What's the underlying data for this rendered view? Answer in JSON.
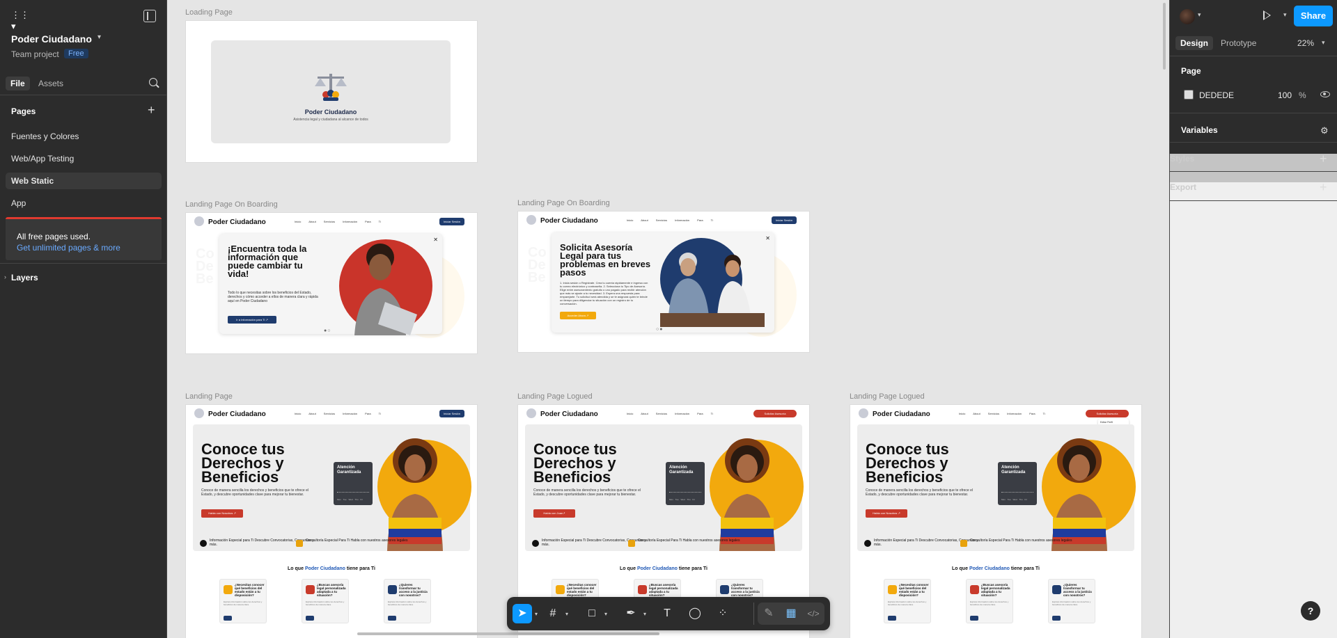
{
  "header": {
    "project_name": "Poder Ciudadano",
    "team": "Team project",
    "plan_badge": "Free",
    "share_label": "Share"
  },
  "left_tabs": {
    "file": "File",
    "assets": "Assets"
  },
  "pages": {
    "header": "Pages",
    "items": [
      {
        "label": "Fuentes y Colores",
        "selected": false
      },
      {
        "label": "Web/App Testing",
        "selected": false
      },
      {
        "label": "Web Static",
        "selected": true
      },
      {
        "label": "App",
        "selected": false
      }
    ]
  },
  "limit_notice": {
    "title": "All free pages used.",
    "link": "Get unlimited pages & more"
  },
  "layers_header": "Layers",
  "right_tabs": {
    "design": "Design",
    "prototype": "Prototype",
    "zoom": "22%"
  },
  "design_panel": {
    "page_header": "Page",
    "background_hex": "DEDEDE",
    "background_opacity": "100",
    "opacity_unit": "%",
    "variables": "Variables",
    "styles": "Styles",
    "export": "Export"
  },
  "frames": {
    "loading": {
      "label": "Loading Page",
      "title": "Poder Ciudadano",
      "subtitle": "Asistencia legal y ciudadana al alcance de todos"
    },
    "onboarding_1": {
      "label": "Landing Page On Boarding",
      "modal_title": "¡Encuentra toda la información que puede cambiar tu vida!",
      "modal_text": "Todo lo que necesitas sobre los beneficios del Estado, derechos y cómo acceder a ellos de manera clara y rápida aquí en Poder Ciudadano",
      "modal_button": "Ir a Información para Ti ↗"
    },
    "onboarding_2": {
      "label": "Landing Page On Boarding",
      "modal_title": "Solicita Asesoría Legal para tus problemas en breves pasos",
      "modal_text": "1. Inicia sesión o Regístrate. Crea tu cuenta rápidamente e ingresa con tu correo electrónico y contraseña. 2. Selecciona tu Tipo de Asesoría. Elige entre asesoramiento gratuito o uno pagado para recibir atención que más se ajuste a tu necesidad. 3. Espera una respuesta para emparejarte. Tu solicitud será atendida y se te asignará quien te brinde un tiempo para diligenciar tu situación con un regístro de tu conversación.",
      "modal_button": "Acceder Ahora ↗"
    },
    "landing": {
      "label": "Landing Page",
      "nav_button": "Iniciar Sesión"
    },
    "logued_1": {
      "label": "Landing Page Logued",
      "nav_button": "Solicitar Asesoría"
    },
    "logued_2": {
      "label": "Landing Page Logued",
      "nav_button": "Solicitar Asesoría",
      "menu_1": "Editar Perfil",
      "menu_2": "Cerrar Sesión"
    }
  },
  "site": {
    "brand": "Poder Ciudadano",
    "nav_links": "Inicio About Servicios Información Para Ti",
    "hero_title": "Conoce tus Derechos y Beneficios",
    "hero_text": "Conoce de manera sencilla los derechos y beneficios que te ofrece el Estado, y descubre oportunidades clave para mejorar tu bienestar.",
    "hero_button": "Habla con Nosotros ↗",
    "hero_button_logued": "Habla con Juan↗",
    "card_title": "Atención Garantizada",
    "card_days": "Mon Tue Wed Thu Fri",
    "feature_1": "Información Especial para Ti Descubre Convocatorias, Concursos y más.",
    "feature_2": "Consultoría Especial Para Ti Habla con nuestros asesores legales",
    "offer_prefix": "Lo que",
    "offer_brand": "Poder Ciudadano",
    "offer_suffix": "tiene para Ti",
    "box_1": "¿Necesitas conocer qué beneficios del estado están a tu disposición?",
    "box_2": "¿Buscas asesoría legal personalizada adaptada a tu situación?",
    "box_3": "¿Quieres transformar tu acceso a la justicia con nosotros?",
    "box_text": "Explora información sobre tus derechos y beneficios de manera clara."
  },
  "colors": {
    "accent": "#0d99ff",
    "brand_navy": "#1f3c6e",
    "brand_red": "#c83a2b",
    "brand_yellow": "#f2a90d",
    "canvas_bg": "#e5e5e5",
    "page_bg": "#DEDEDE"
  }
}
